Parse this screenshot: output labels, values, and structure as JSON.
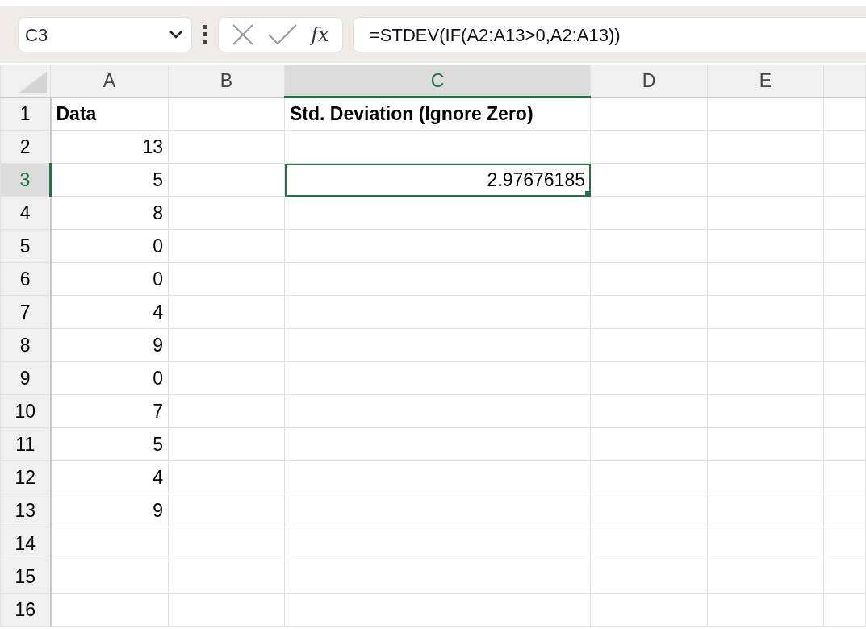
{
  "name_box": {
    "value": "C3"
  },
  "formula_bar": {
    "function_label": "fx",
    "value": "=STDEV(IF(A2:A13>0,A2:A13))"
  },
  "columns": [
    {
      "label": "A",
      "selected": false
    },
    {
      "label": "B",
      "selected": false
    },
    {
      "label": "C",
      "selected": true
    },
    {
      "label": "D",
      "selected": false
    },
    {
      "label": "E",
      "selected": false
    }
  ],
  "rows": [
    {
      "label": "1",
      "selected": false,
      "cells": {
        "A": {
          "text": "Data",
          "kind": "text",
          "bold": true,
          "selected": false
        },
        "C": {
          "text": "Std. Deviation (Ignore Zero)",
          "kind": "text",
          "bold": true,
          "selected": false
        }
      }
    },
    {
      "label": "2",
      "selected": false,
      "cells": {
        "A": {
          "text": "13",
          "kind": "number",
          "bold": false,
          "selected": false
        }
      }
    },
    {
      "label": "3",
      "selected": true,
      "cells": {
        "A": {
          "text": "5",
          "kind": "number",
          "bold": false,
          "selected": false
        },
        "C": {
          "text": "2.97676185",
          "kind": "number",
          "bold": false,
          "selected": true
        }
      }
    },
    {
      "label": "4",
      "selected": false,
      "cells": {
        "A": {
          "text": "8",
          "kind": "number",
          "bold": false,
          "selected": false
        }
      }
    },
    {
      "label": "5",
      "selected": false,
      "cells": {
        "A": {
          "text": "0",
          "kind": "number",
          "bold": false,
          "selected": false
        }
      }
    },
    {
      "label": "6",
      "selected": false,
      "cells": {
        "A": {
          "text": "0",
          "kind": "number",
          "bold": false,
          "selected": false
        }
      }
    },
    {
      "label": "7",
      "selected": false,
      "cells": {
        "A": {
          "text": "4",
          "kind": "number",
          "bold": false,
          "selected": false
        }
      }
    },
    {
      "label": "8",
      "selected": false,
      "cells": {
        "A": {
          "text": "9",
          "kind": "number",
          "bold": false,
          "selected": false
        }
      }
    },
    {
      "label": "9",
      "selected": false,
      "cells": {
        "A": {
          "text": "0",
          "kind": "number",
          "bold": false,
          "selected": false
        }
      }
    },
    {
      "label": "10",
      "selected": false,
      "cells": {
        "A": {
          "text": "7",
          "kind": "number",
          "bold": false,
          "selected": false
        }
      }
    },
    {
      "label": "11",
      "selected": false,
      "cells": {
        "A": {
          "text": "5",
          "kind": "number",
          "bold": false,
          "selected": false
        }
      }
    },
    {
      "label": "12",
      "selected": false,
      "cells": {
        "A": {
          "text": "4",
          "kind": "number",
          "bold": false,
          "selected": false
        }
      }
    },
    {
      "label": "13",
      "selected": false,
      "cells": {
        "A": {
          "text": "9",
          "kind": "number",
          "bold": false,
          "selected": false
        }
      }
    },
    {
      "label": "14",
      "selected": false,
      "cells": {}
    },
    {
      "label": "15",
      "selected": false,
      "cells": {}
    },
    {
      "label": "16",
      "selected": false,
      "cells": {}
    }
  ]
}
